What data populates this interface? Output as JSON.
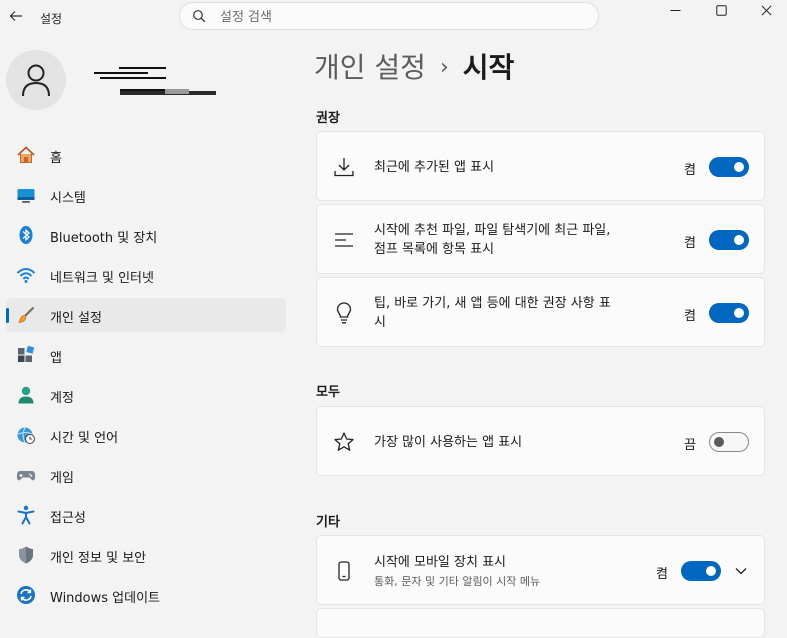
{
  "window": {
    "app_title": "설정",
    "search_placeholder": "설정 검색"
  },
  "nav": {
    "items": [
      {
        "label": "홈",
        "icon": "home-icon"
      },
      {
        "label": "시스템",
        "icon": "system-icon"
      },
      {
        "label": "Bluetooth 및 장치",
        "icon": "bluetooth-icon"
      },
      {
        "label": "네트워크 및 인터넷",
        "icon": "wifi-icon"
      },
      {
        "label": "개인 설정",
        "icon": "brush-icon",
        "selected": true
      },
      {
        "label": "앱",
        "icon": "apps-icon"
      },
      {
        "label": "계정",
        "icon": "account-icon"
      },
      {
        "label": "시간 및 언어",
        "icon": "globe-clock-icon"
      },
      {
        "label": "게임",
        "icon": "gamepad-icon"
      },
      {
        "label": "접근성",
        "icon": "accessibility-icon"
      },
      {
        "label": "개인 정보 및 보안",
        "icon": "shield-icon"
      },
      {
        "label": "Windows 업데이트",
        "icon": "update-icon"
      }
    ]
  },
  "breadcrumb": {
    "parent": "개인 설정",
    "separator": "›",
    "current": "시작"
  },
  "sections": {
    "recommended": "권장",
    "all": "모두",
    "other": "기타"
  },
  "settings": {
    "recent_apps": {
      "line1": "최근에 추가된 앱 표시",
      "state": "켬",
      "on": true
    },
    "recommended_files": {
      "line1": "시작에 추천 파일, 파일 탐색기에 최근 파일,",
      "line2": "점프 목록에 항목 표시",
      "state": "켬",
      "on": true
    },
    "tips": {
      "line1": "팁, 바로 가기, 새 앱 등에 대한 권장 사항 표",
      "line2": "시",
      "state": "켬",
      "on": true
    },
    "most_used": {
      "line1": "가장 많이 사용하는 앱 표시",
      "state": "끔",
      "on": false
    },
    "mobile": {
      "line1": "시작에 모바일 장치 표시",
      "sub": "통화, 문자 및 기타 알림이 시작 메뉴",
      "state": "켬",
      "on": true
    }
  },
  "colors": {
    "accent": "#0067c0",
    "background": "#f3f3f3",
    "card": "#fbfbfb"
  }
}
